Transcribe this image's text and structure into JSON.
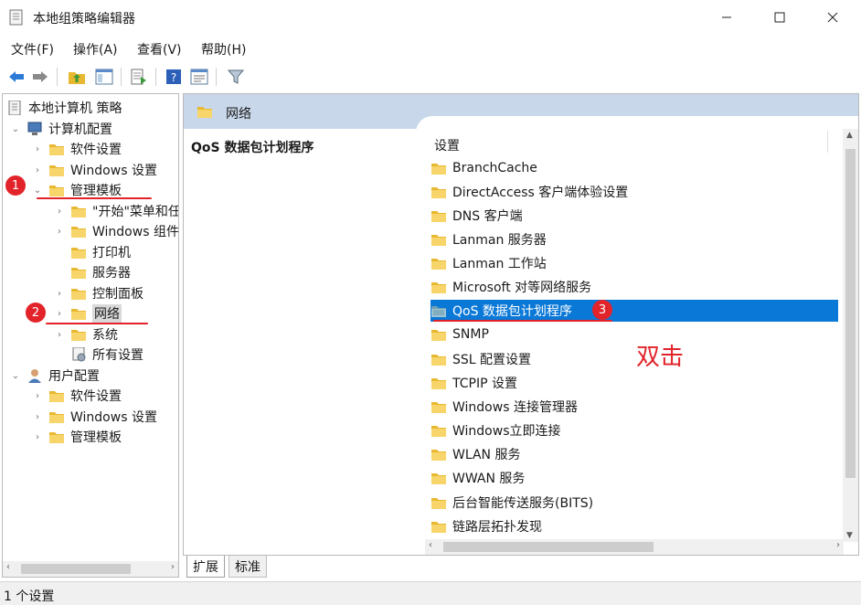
{
  "window": {
    "title": "本地组策略编辑器"
  },
  "menu": [
    {
      "label": "文件(F)"
    },
    {
      "label": "操作(A)"
    },
    {
      "label": "查看(V)"
    },
    {
      "label": "帮助(H)"
    }
  ],
  "toolbar": {
    "icons": [
      "back-arrow-icon",
      "forward-arrow-icon",
      "up-folder-icon",
      "show-hide-tree-icon",
      "export-list-icon",
      "help-icon",
      "properties-icon",
      "filter-icon"
    ]
  },
  "tree": {
    "items": [
      {
        "label": "本地计算机 策略"
      },
      {
        "label": "计算机配置"
      },
      {
        "label": "软件设置"
      },
      {
        "label": "Windows 设置"
      },
      {
        "label": "管理模板"
      },
      {
        "label": "\"开始\"菜单和任"
      },
      {
        "label": "Windows 组件"
      },
      {
        "label": "打印机"
      },
      {
        "label": "服务器"
      },
      {
        "label": "控制面板"
      },
      {
        "label": "网络"
      },
      {
        "label": "系统"
      },
      {
        "label": "所有设置"
      },
      {
        "label": "用户配置"
      },
      {
        "label": "软件设置"
      },
      {
        "label": "Windows 设置"
      },
      {
        "label": "管理模板"
      }
    ]
  },
  "right": {
    "header": "网络",
    "desc_title": "QoS 数据包计划程序",
    "column_header": "设置",
    "items": [
      {
        "label": "BranchCache"
      },
      {
        "label": "DirectAccess 客户端体验设置"
      },
      {
        "label": "DNS 客户端"
      },
      {
        "label": "Lanman 服务器"
      },
      {
        "label": "Lanman 工作站"
      },
      {
        "label": "Microsoft 对等网络服务"
      },
      {
        "label": "QoS 数据包计划程序"
      },
      {
        "label": "SNMP"
      },
      {
        "label": "SSL 配置设置"
      },
      {
        "label": "TCPIP 设置"
      },
      {
        "label": "Windows 连接管理器"
      },
      {
        "label": "Windows立即连接"
      },
      {
        "label": "WLAN 服务"
      },
      {
        "label": "WWAN 服务"
      },
      {
        "label": "后台智能传送服务(BITS)"
      },
      {
        "label": "链路层拓扑发现"
      }
    ]
  },
  "tabs": [
    {
      "label": "扩展"
    },
    {
      "label": "标准"
    }
  ],
  "status": {
    "text": "1 个设置"
  },
  "annotations": {
    "badges": [
      "1",
      "2",
      "3"
    ],
    "note": "双击",
    "color": "#e2232a"
  },
  "colors": {
    "selection": "#0a78d7",
    "header_band": "#c8d8ea",
    "folder": "#f5c842"
  }
}
